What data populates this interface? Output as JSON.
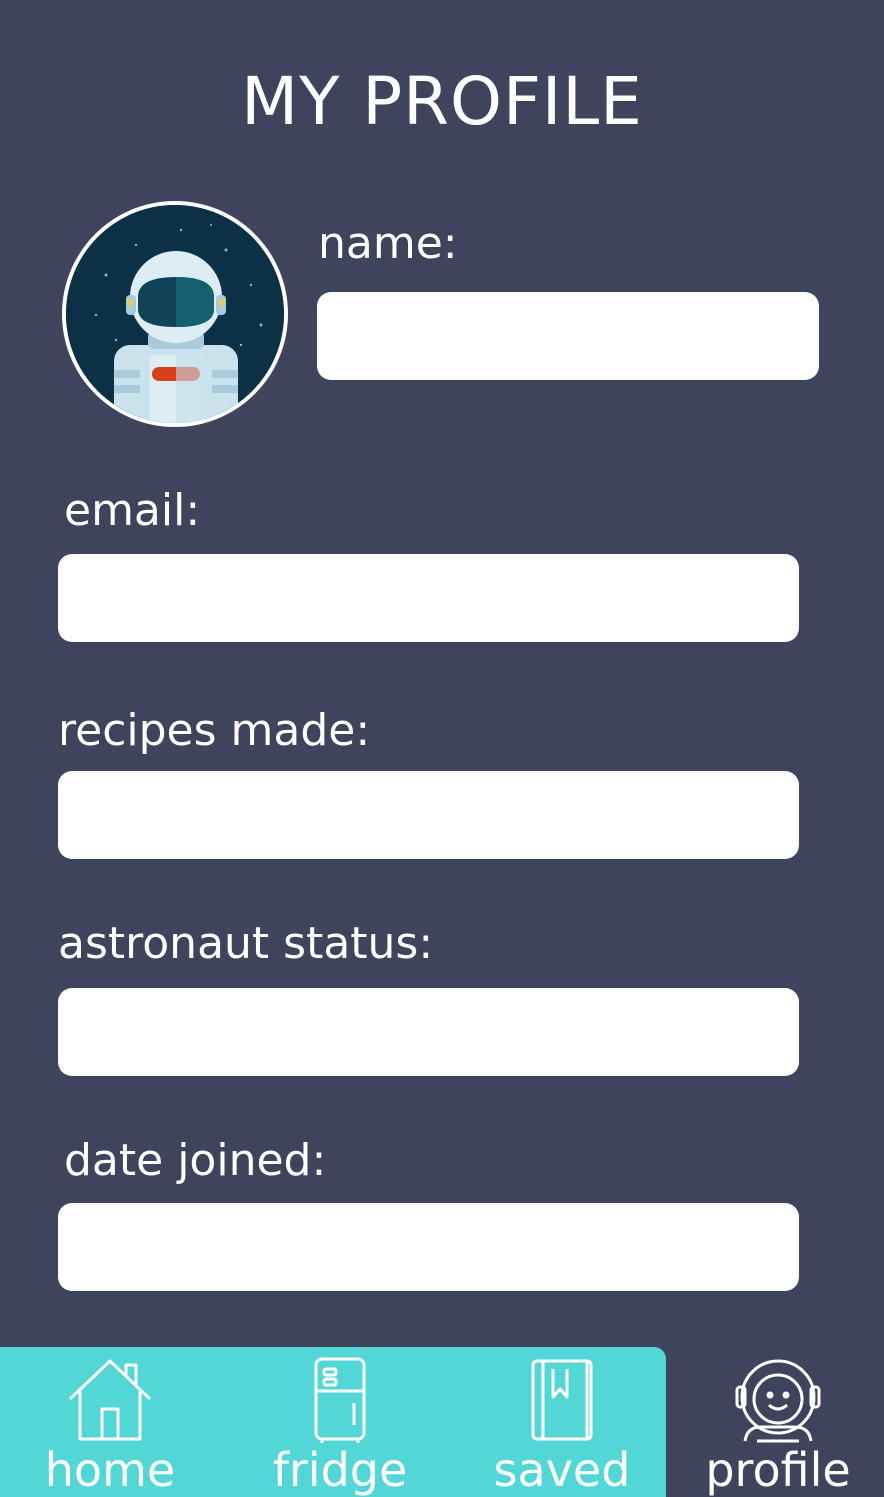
{
  "page": {
    "title": "MY PROFILE"
  },
  "profile": {
    "avatar_icon": "astronaut-avatar-icon",
    "fields": {
      "name": {
        "label": "name:",
        "value": "",
        "placeholder": ""
      },
      "email": {
        "label": "email:",
        "value": "",
        "placeholder": ""
      },
      "recipes_made": {
        "label": "recipes made:",
        "value": "",
        "placeholder": ""
      },
      "astronaut_status": {
        "label": "astronaut status:",
        "value": "",
        "placeholder": ""
      },
      "date_joined": {
        "label": "date joined:",
        "value": "",
        "placeholder": ""
      }
    }
  },
  "nav": {
    "items": [
      {
        "label": "home",
        "icon": "house-icon",
        "active": false
      },
      {
        "label": "fridge",
        "icon": "fridge-icon",
        "active": false
      },
      {
        "label": "saved",
        "icon": "book-icon",
        "active": false
      },
      {
        "label": "profile",
        "icon": "astronaut-icon",
        "active": true
      }
    ]
  },
  "colors": {
    "background": "#3f445c",
    "nav_accent": "#52d6d6",
    "text": "#ffffff",
    "input_background": "#ffffff"
  }
}
